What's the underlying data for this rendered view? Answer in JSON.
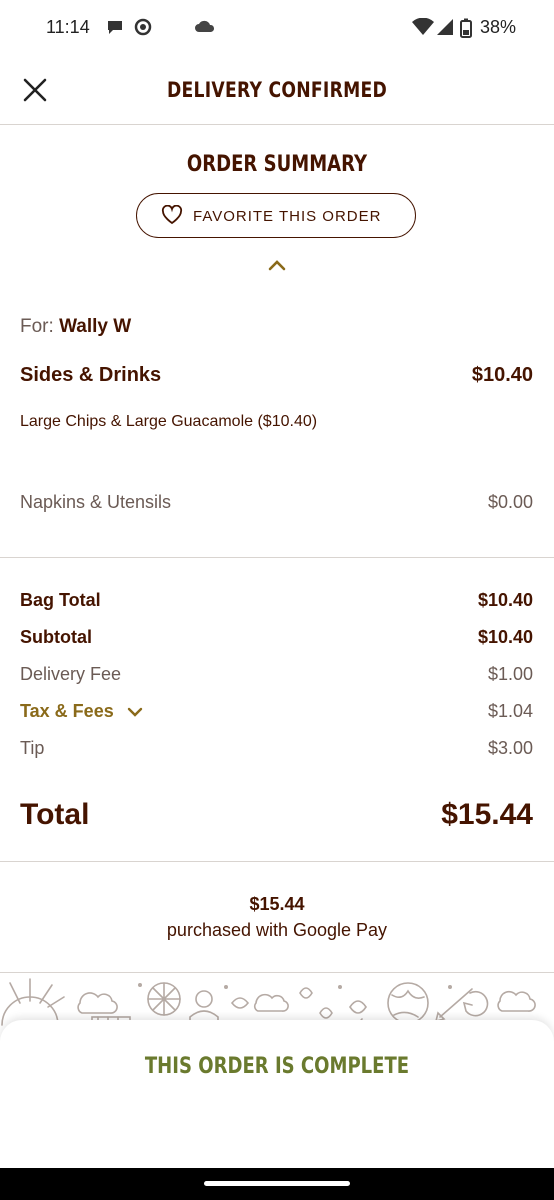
{
  "status_bar": {
    "time": "11:14",
    "battery": "38%"
  },
  "header": {
    "title": "DELIVERY CONFIRMED",
    "close_icon": "close-icon"
  },
  "summary": {
    "title": "ORDER SUMMARY",
    "favorite_label": "FAVORITE THIS ORDER",
    "for_label": "For:",
    "customer_name": "Wally W",
    "group_name": "Sides & Drinks",
    "group_price": "$10.40",
    "item_text": "Large Chips & Large Guacamole ($10.40)",
    "napkins_label": "Napkins & Utensils",
    "napkins_price": "$0.00"
  },
  "totals": {
    "bag_total_label": "Bag Total",
    "bag_total": "$10.40",
    "subtotal_label": "Subtotal",
    "subtotal": "$10.40",
    "delivery_label": "Delivery Fee",
    "delivery": "$1.00",
    "tax_label": "Tax & Fees",
    "tax": "$1.04",
    "tip_label": "Tip",
    "tip": "$3.00",
    "total_label": "Total",
    "total": "$15.44"
  },
  "payment": {
    "amount": "$15.44",
    "method": "purchased with Google Pay"
  },
  "sheet": {
    "title": "THIS ORDER IS COMPLETE"
  },
  "colors": {
    "brand_brown": "#451400",
    "muted": "#6b5b55",
    "gold": "#8a6a1a",
    "complete_green": "#6a7a2e"
  }
}
